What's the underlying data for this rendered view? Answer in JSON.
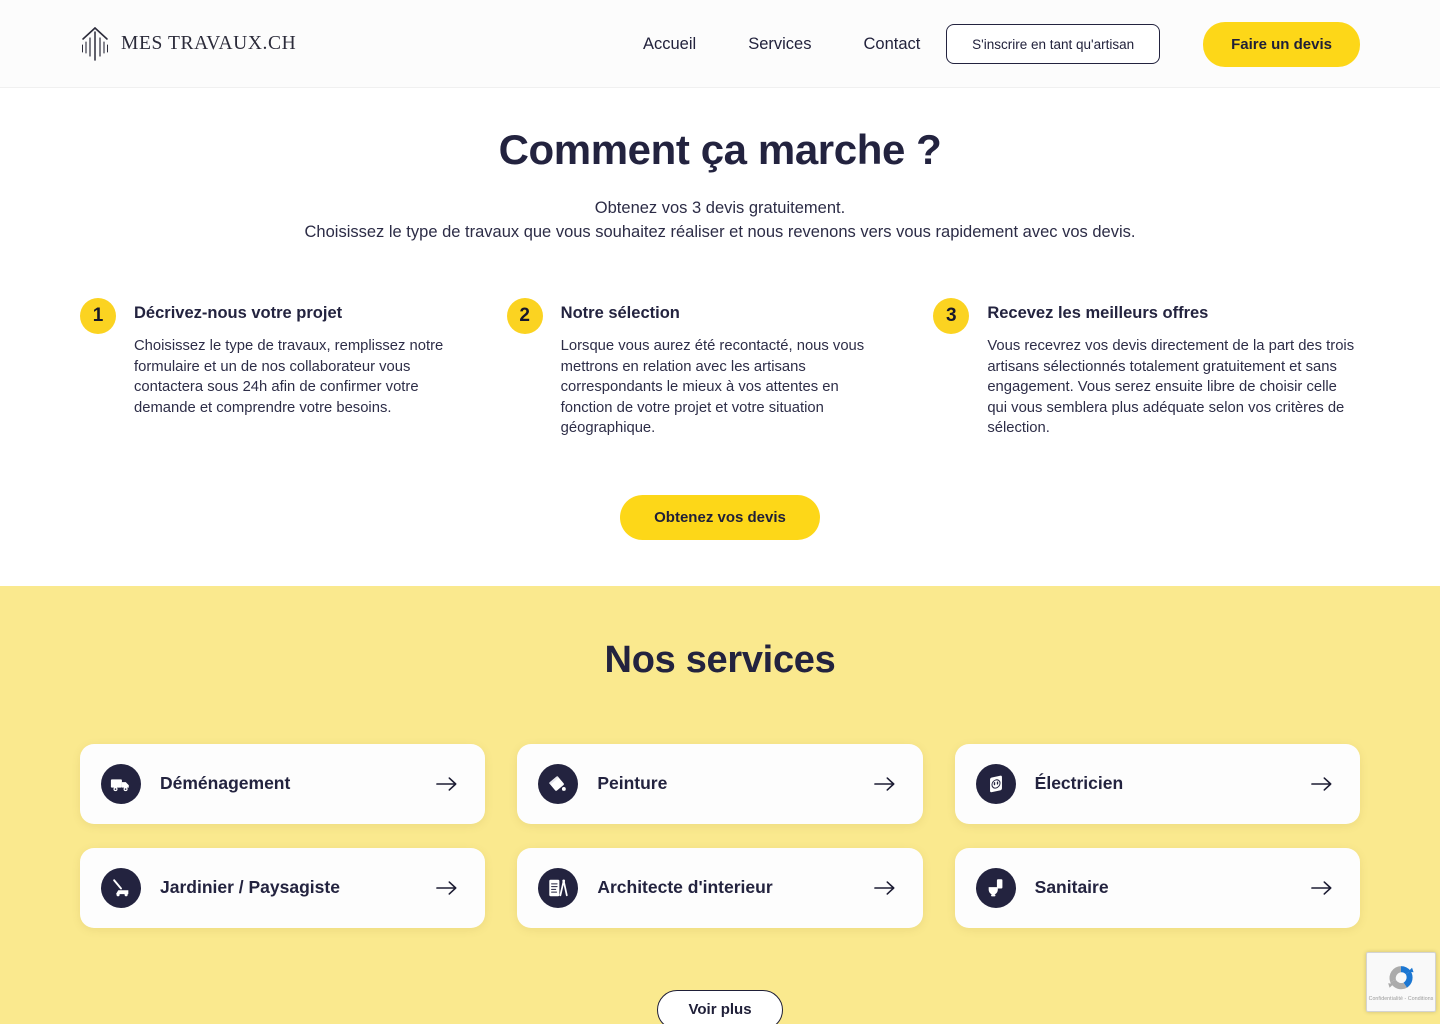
{
  "brand": {
    "name": "MES TRAVAUX.CH",
    "logo_icon": "house-columns-icon"
  },
  "header": {
    "nav": [
      {
        "label": "Accueil",
        "name": "nav-accueil"
      },
      {
        "label": "Services",
        "name": "nav-services"
      },
      {
        "label": "Contact",
        "name": "nav-contact"
      }
    ],
    "signup_label": "S'inscrire en tant qu'artisan",
    "quote_label": "Faire un devis"
  },
  "howto": {
    "title": "Comment ça marche ?",
    "subtitle_line1": "Obtenez vos 3 devis gratuitement.",
    "subtitle_line2": "Choisissez le type de travaux que vous souhaitez réaliser et nous revenons vers vous rapidement avec vos devis.",
    "steps": [
      {
        "number": "1",
        "title": "Décrivez-nous votre projet",
        "text": "Choisissez le type de travaux, remplissez notre formulaire et un de nos collaborateur vous contactera sous 24h afin de confirmer votre demande et comprendre votre besoins."
      },
      {
        "number": "2",
        "title": "Notre sélection",
        "text": "Lorsque vous aurez été recontacté, nous vous mettrons en relation avec les artisans correspondants le mieux à vos attentes en fonction de votre projet et votre situation géographique."
      },
      {
        "number": "3",
        "title": "Recevez les meilleurs offres",
        "text": "Vous recevrez vos devis directement de la part des trois artisans sélectionnés totalement gratuitement et sans engagement. Vous serez ensuite libre de choisir celle qui vous semblera plus adéquate selon vos critères de sélection."
      }
    ],
    "cta_label": "Obtenez vos devis"
  },
  "services": {
    "title": "Nos services",
    "items": [
      {
        "label": "Déménagement",
        "icon": "moving-truck-icon"
      },
      {
        "label": "Peinture",
        "icon": "paint-bucket-icon"
      },
      {
        "label": "Électricien",
        "icon": "power-outlet-icon"
      },
      {
        "label": "Jardinier / Paysagiste",
        "icon": "lawnmower-icon"
      },
      {
        "label": "Architecte d'interieur",
        "icon": "blueprint-compass-icon"
      },
      {
        "label": "Sanitaire",
        "icon": "toilet-icon"
      }
    ],
    "more_label": "Voir plus",
    "arrow_icon": "arrow-right-icon"
  },
  "recaptcha": {
    "logo_icon": "recaptcha-icon",
    "links": "Confidentialité - Conditions"
  },
  "colors": {
    "accent_yellow": "#FDD718",
    "section_yellow": "#FAE98E",
    "ink": "#23233F",
    "card_white": "#FDFDFD"
  }
}
